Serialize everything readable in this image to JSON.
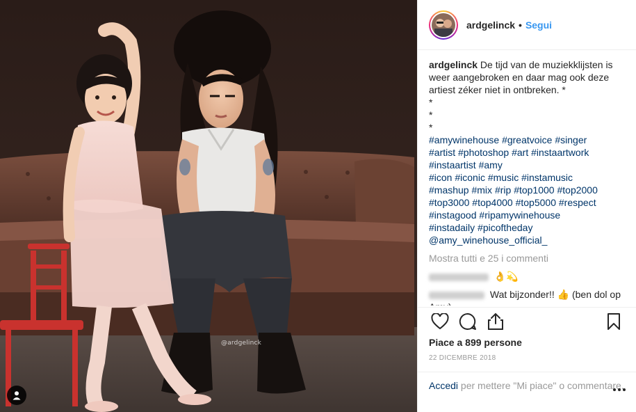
{
  "header": {
    "username": "ardgelinck",
    "separator": "•",
    "follow_label": "Segui"
  },
  "caption": {
    "username": "ardgelinck",
    "text": "De tijd van de muziekklijsten is weer aangebroken en daar mag ook deze artiest zéker niet in ontbreken. *",
    "stars": [
      "*",
      "*",
      "*"
    ],
    "hashtag_lines": [
      [
        "#amywinehouse",
        "#greatvoice",
        "#singer"
      ],
      [
        "#artist",
        "#photoshop",
        "#art",
        "#instaartwork"
      ],
      [
        "#instaartist",
        "#amy"
      ],
      [
        "#icon",
        "#iconic",
        "#music",
        "#instamusic"
      ],
      [
        "#mashup",
        "#mix",
        "#rip",
        "#top1000",
        "#top2000"
      ],
      [
        "#top3000",
        "#top4000",
        "#top5000",
        "#respect"
      ],
      [
        "#instagood",
        "#ripamywinehouse"
      ],
      [
        "#instadaily",
        "#picoftheday"
      ],
      [
        "@amy_winehouse_official_"
      ]
    ]
  },
  "view_all_comments": "Mostra tutti e 25 i commenti",
  "comments": [
    {
      "text": "👌💫"
    },
    {
      "text": "Wat bijzonder!! 👍 (ben dol op Amy)"
    }
  ],
  "likes": {
    "prefix": "Piace a",
    "count": "899",
    "suffix": "persone"
  },
  "date": "22 DICEMBRE 2018",
  "login": {
    "link": "Accedi",
    "text": "per mettere \"Mi piace\" o commentare."
  },
  "photo": {
    "watermark": "@ardgelinck"
  },
  "icons": {
    "user_tag": "user-icon",
    "like": "heart-icon",
    "comment": "comment-icon",
    "share": "share-icon",
    "save": "bookmark-icon",
    "more": "more-options-icon"
  }
}
